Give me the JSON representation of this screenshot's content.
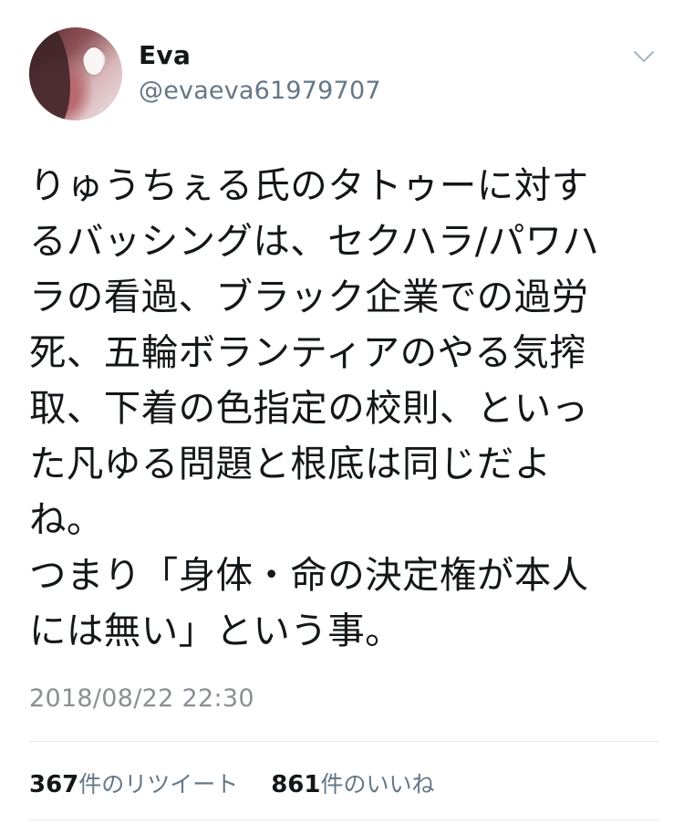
{
  "author": {
    "name": "Eva",
    "handle": "@evaeva61979707"
  },
  "icons": {
    "menu": "chevron-down-icon",
    "avatar": "profile-photo"
  },
  "tweet": {
    "text": "りゅうちぇる氏のタトゥーに対す\nるバッシングは、セクハラ/パワハ\nラの看過、ブラック企業での過労\n死、五輪ボランティアのやる気搾\n取、下着の色指定の校則、といっ\nた凡ゆる問題と根底は同じだよ\nね。\nつまり「身体・命の決定権が本人\nには無い」という事。",
    "timestamp": "2018/08/22 22:30"
  },
  "stats": {
    "retweets_count": "367",
    "retweets_label": "件のリツイート",
    "likes_count": "861",
    "likes_label": "件のいいね"
  },
  "colors": {
    "text": "#14171a",
    "secondary": "#657786",
    "divider": "#e1e8ed"
  }
}
